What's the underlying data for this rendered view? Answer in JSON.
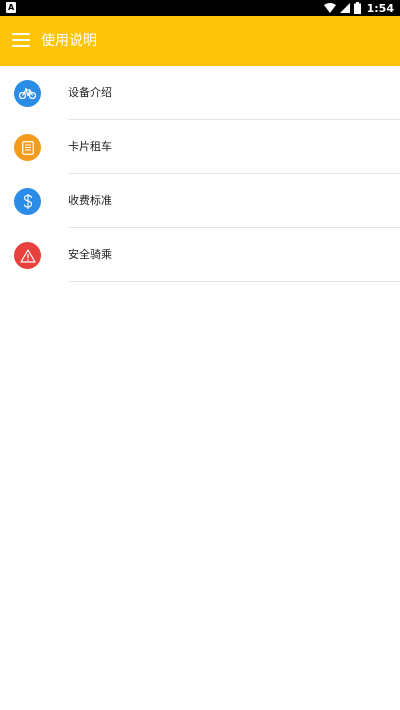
{
  "status_bar": {
    "time": "1:54"
  },
  "app_bar": {
    "title": "使用说明",
    "menu_icon": "menu-icon"
  },
  "menu_items": [
    {
      "label": "设备介绍",
      "icon": "bike-icon",
      "color": "#2A8CE6"
    },
    {
      "label": "卡片租车",
      "icon": "card-icon",
      "color": "#F39B1E"
    },
    {
      "label": "收费标准",
      "icon": "dollar-icon",
      "color": "#2A8CE6"
    },
    {
      "label": "安全骑乘",
      "icon": "warning-icon",
      "color": "#E8403A"
    }
  ],
  "colors": {
    "primary": "#FEC40A"
  }
}
